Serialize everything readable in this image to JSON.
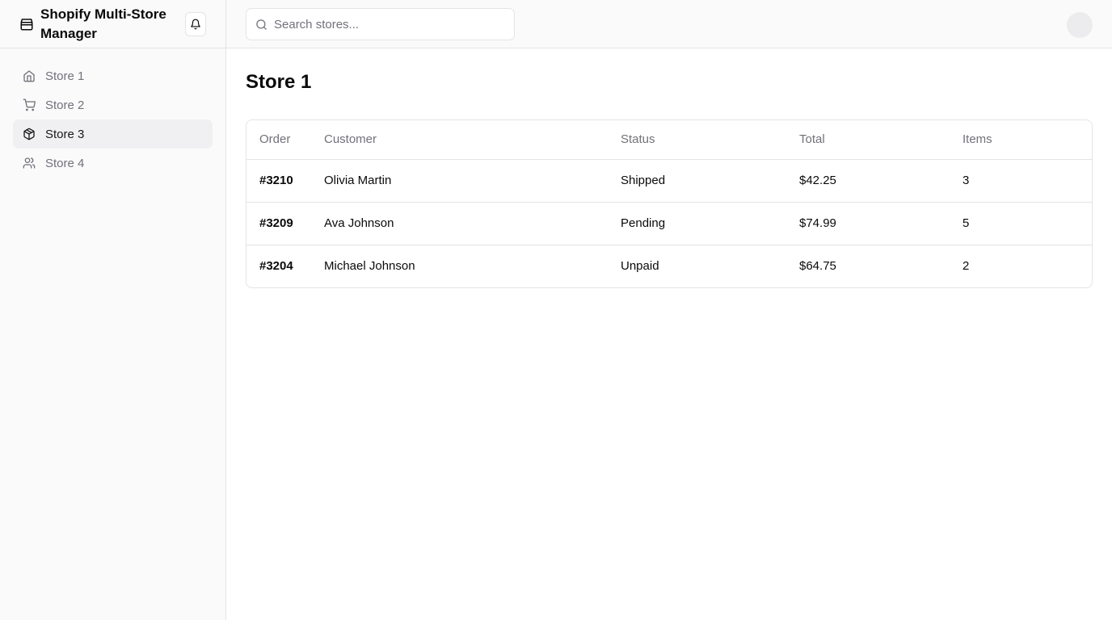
{
  "app": {
    "title": "Shopify Multi-Store Manager"
  },
  "sidebar": {
    "items": [
      {
        "label": "Store 1",
        "icon": "home-icon",
        "active": false
      },
      {
        "label": "Store 2",
        "icon": "cart-icon",
        "active": false
      },
      {
        "label": "Store 3",
        "icon": "package-icon",
        "active": true
      },
      {
        "label": "Store 4",
        "icon": "users-icon",
        "active": false
      }
    ]
  },
  "topbar": {
    "search_placeholder": "Search stores...",
    "search_value": ""
  },
  "main": {
    "title": "Store 1",
    "table": {
      "headers": [
        "Order",
        "Customer",
        "Status",
        "Total",
        "Items"
      ],
      "rows": [
        {
          "order": "#3210",
          "customer": "Olivia Martin",
          "status": "Shipped",
          "total": "$42.25",
          "items": "3"
        },
        {
          "order": "#3209",
          "customer": "Ava Johnson",
          "status": "Pending",
          "total": "$74.99",
          "items": "5"
        },
        {
          "order": "#3204",
          "customer": "Michael Johnson",
          "status": "Unpaid",
          "total": "$64.75",
          "items": "2"
        }
      ]
    }
  },
  "colors": {
    "sidebar_bg": "#fafafa",
    "border": "#e4e4e7",
    "muted_text": "#71717a",
    "active_bg": "#f0f0f2"
  }
}
